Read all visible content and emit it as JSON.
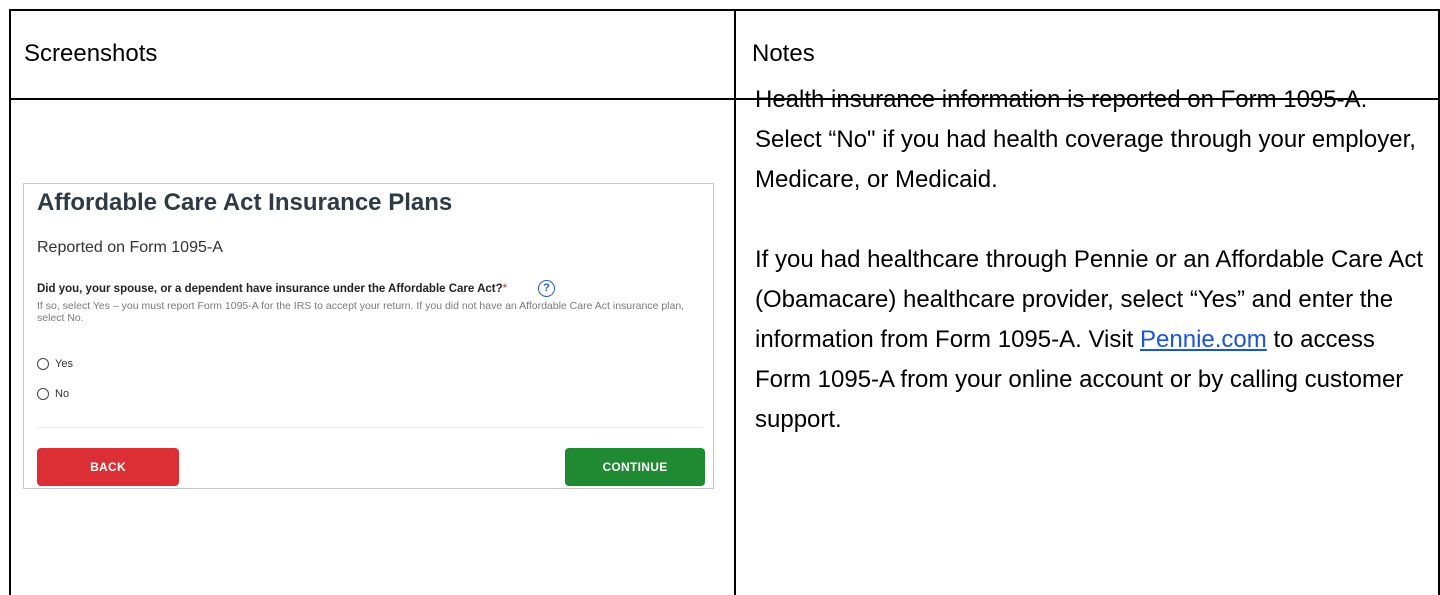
{
  "table": {
    "headers": [
      "Screenshots",
      "Notes"
    ]
  },
  "screenshot": {
    "title": "Affordable Care Act Insurance Plans",
    "subtitle": "Reported on Form 1095-A",
    "question": "Did you, your spouse, or a dependent have insurance under the Affordable Care Act?",
    "required_mark": "*",
    "help_icon_glyph": "?",
    "help_text": "If so, select Yes – you must report Form 1095-A for the IRS to accept your return. If you did not have an Affordable Care Act insurance plan, select No.",
    "options": [
      "Yes",
      "No"
    ],
    "back_label": "BACK",
    "continue_label": "CONTINUE",
    "colors": {
      "back": "#dc2f35",
      "continue": "#1f8a32",
      "help": "#1e5fd6"
    }
  },
  "notes": {
    "paragraph1": "Health insurance information is reported on Form 1095-A. Select “No\" if you had health coverage through your employer, Medicare, or Medicaid.",
    "paragraph2_before": "If you had healthcare through Pennie or an Affordable Care Act (Obamacare) healthcare provider, select “Yes” and enter the information from Form 1095-A.  Visit ",
    "link_text": "Pennie.com",
    "paragraph2_after": " to access Form 1095-A from your online account or by calling customer support.",
    "link_color": "#1a55d6"
  }
}
